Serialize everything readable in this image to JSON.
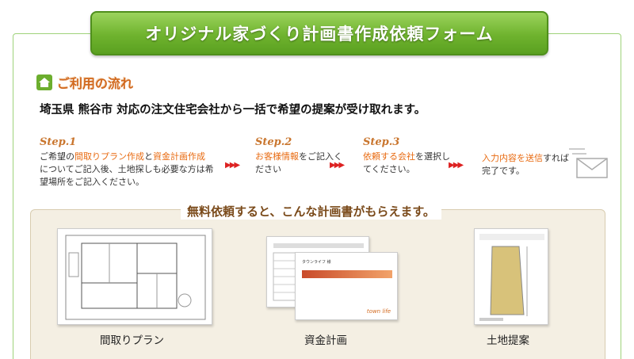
{
  "form": {
    "title": "オリジナル家づくり計画書作成依頼フォーム",
    "flow_heading": "ご利用の流れ",
    "lead": "埼玉県 熊谷市 対応の注文住宅会社から一括で希望の提案が受け取れます。"
  },
  "steps": [
    {
      "title": "Step.1",
      "pre": "ご希望の",
      "hl1": "間取りプラン作成",
      "mid": "と",
      "hl2": "資金計画作成",
      "post": "についてご記入後、土地探しも必要な方は希望場所をご記入ください。"
    },
    {
      "title": "Step.2",
      "hl": "お客様情報",
      "post": "をご記入ください"
    },
    {
      "title": "Step.3",
      "hl": "依頼する会社",
      "post": "を選択してください。"
    },
    {
      "hl": "入力内容を送信",
      "post": "すれば完了です。"
    }
  ],
  "arrows": "▶▶▶",
  "samples": {
    "heading": "無料依頼すると、こんな計画書がもらえます。",
    "items": [
      {
        "caption": "間取りプラン"
      },
      {
        "caption": "資金計画"
      },
      {
        "caption": "土地提案"
      }
    ],
    "fund_doc_title": "タウンライフ 様",
    "fund_doc_brand": "town life"
  },
  "icons": {
    "flow": "home-icon",
    "send": "mail-icon",
    "arrow": "arrow-icon"
  },
  "colors": {
    "accent_green": "#6fb32e",
    "highlight_orange": "#e86a10",
    "step_title": "#c9752d",
    "arrow_red": "#d22222"
  }
}
